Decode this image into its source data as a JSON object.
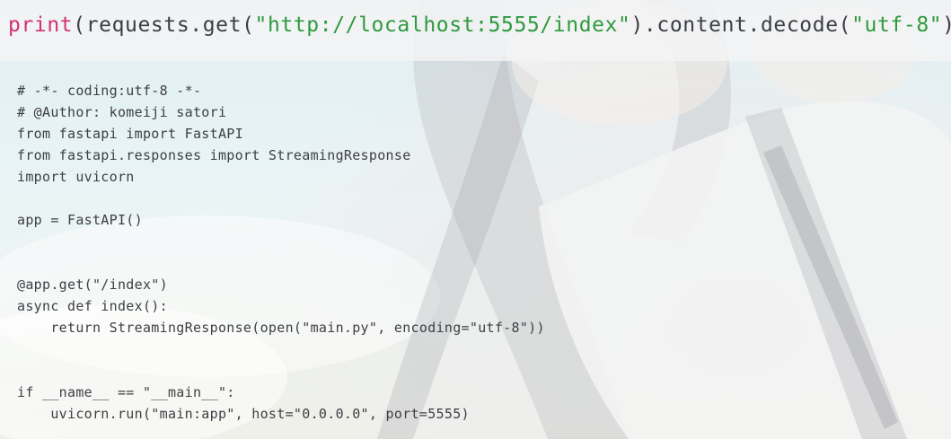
{
  "top_line": {
    "fn": "print",
    "p1": "(requests.get(",
    "url": "\"http://localhost:5555/index\"",
    "p2": ").content.decode(",
    "enc": "\"utf-8\"",
    "p3": "))"
  },
  "code_lines": [
    "# -*- coding:utf-8 -*-",
    "# @Author: komeiji satori",
    "from fastapi import FastAPI",
    "from fastapi.responses import StreamingResponse",
    "import uvicorn",
    "",
    "app = FastAPI()",
    "",
    "",
    "@app.get(\"/index\")",
    "async def index():",
    "    return StreamingResponse(open(\"main.py\", encoding=\"utf-8\"))",
    "",
    "",
    "if __name__ == \"__main__\":",
    "    uvicorn.run(\"main:app\", host=\"0.0.0.0\", port=5555)"
  ],
  "colors": {
    "function": "#d03376",
    "string": "#2f9a3e",
    "text": "#3c3f44"
  }
}
